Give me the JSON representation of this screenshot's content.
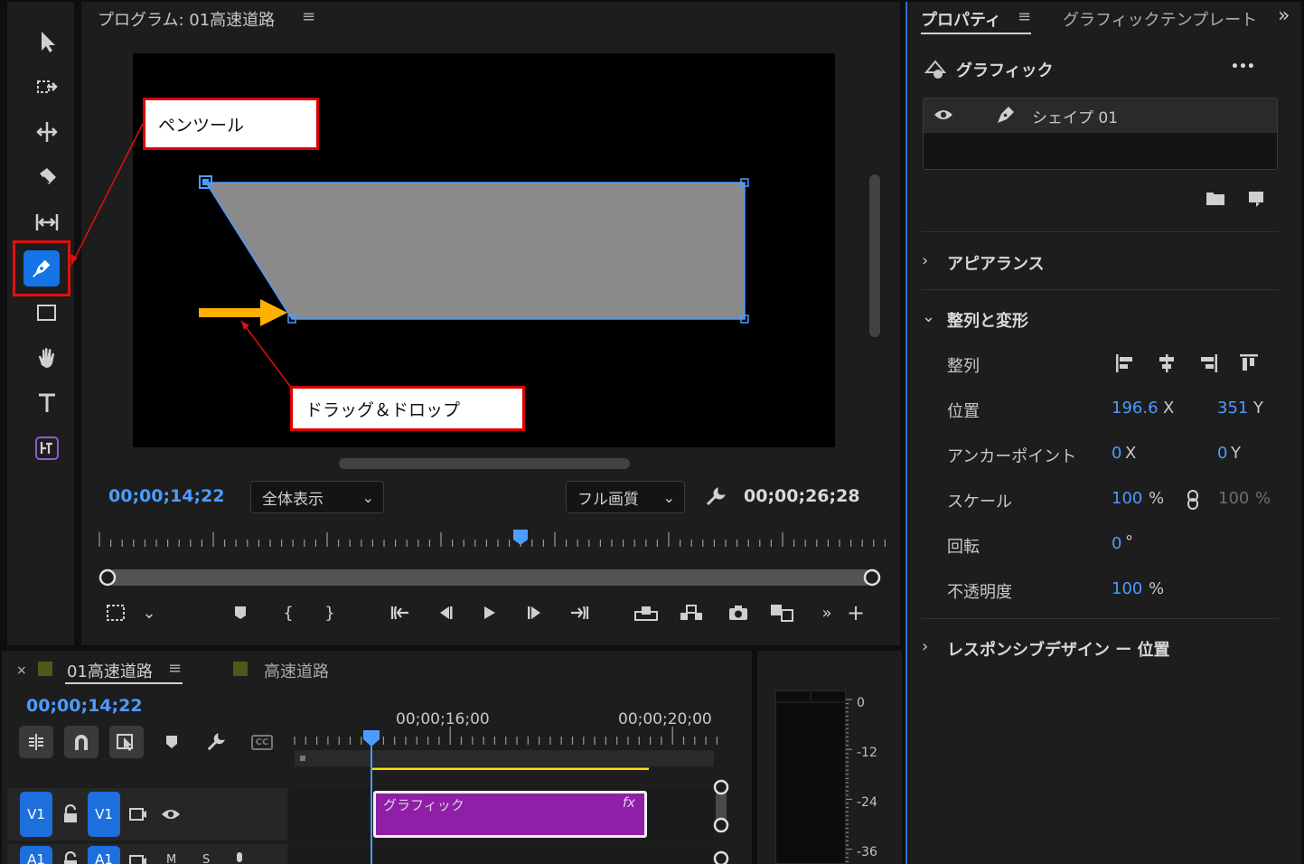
{
  "program": {
    "title": "プログラム: 01高速道路",
    "menu_icon": "≡",
    "timecode_current": "00;00;14;22",
    "timecode_duration": "00;00;26;28",
    "zoom_select": "全体表示",
    "quality_select": "フル画質"
  },
  "callouts": {
    "pen_tool": "ペンツール",
    "drag_drop": "ドラッグ＆ドロップ"
  },
  "properties": {
    "tab_active": "プロパティ",
    "tab_other": "グラフィックテンプレート",
    "menu_icon": "≡",
    "overflow": "»",
    "section_graphic": "グラフィック",
    "more": "•••",
    "layer_name": "シェイプ 01",
    "appearance": "アピアランス",
    "align_transform": "整列と変形",
    "align_label": "整列",
    "position_label": "位置",
    "position_x": "196.6",
    "position_y": "351",
    "anchor_label": "アンカーポイント",
    "anchor_x": "0",
    "anchor_y": "0",
    "scale_label": "スケール",
    "scale_value": "100",
    "scale_value2": "100",
    "percent": "%",
    "rotation_label": "回転",
    "rotation_value": "0",
    "degree": "°",
    "opacity_label": "不透明度",
    "opacity_value": "100",
    "x_unit": "X",
    "y_unit": "Y",
    "responsive": "レスポンシブデザイン ー 位置"
  },
  "timeline": {
    "close": "×",
    "tab_active": "01高速道路",
    "menu_icon": "≡",
    "tab_other": "高速道路",
    "timecode": "00;00;14;22",
    "ruler_label_1": "00;00;16;00",
    "ruler_label_2": "00;00;20;00",
    "track_v1": "V1",
    "track_v1_target": "V1",
    "track_a1": "A1",
    "track_a1_target": "A1",
    "track_m": "M",
    "track_s": "S",
    "clip_name": "グラフィック",
    "clip_fx": "fx"
  },
  "meter": {
    "labels": [
      "0",
      "-12",
      "-24",
      "-36"
    ]
  },
  "colors": {
    "accent_blue": "#1473e6",
    "timecode_blue": "#4d9bff",
    "clip_purple": "#8e1fa6",
    "shape_gray": "#8a8a8a",
    "callout_red": "#dd0000",
    "arrow_orange": "#ffb000"
  }
}
